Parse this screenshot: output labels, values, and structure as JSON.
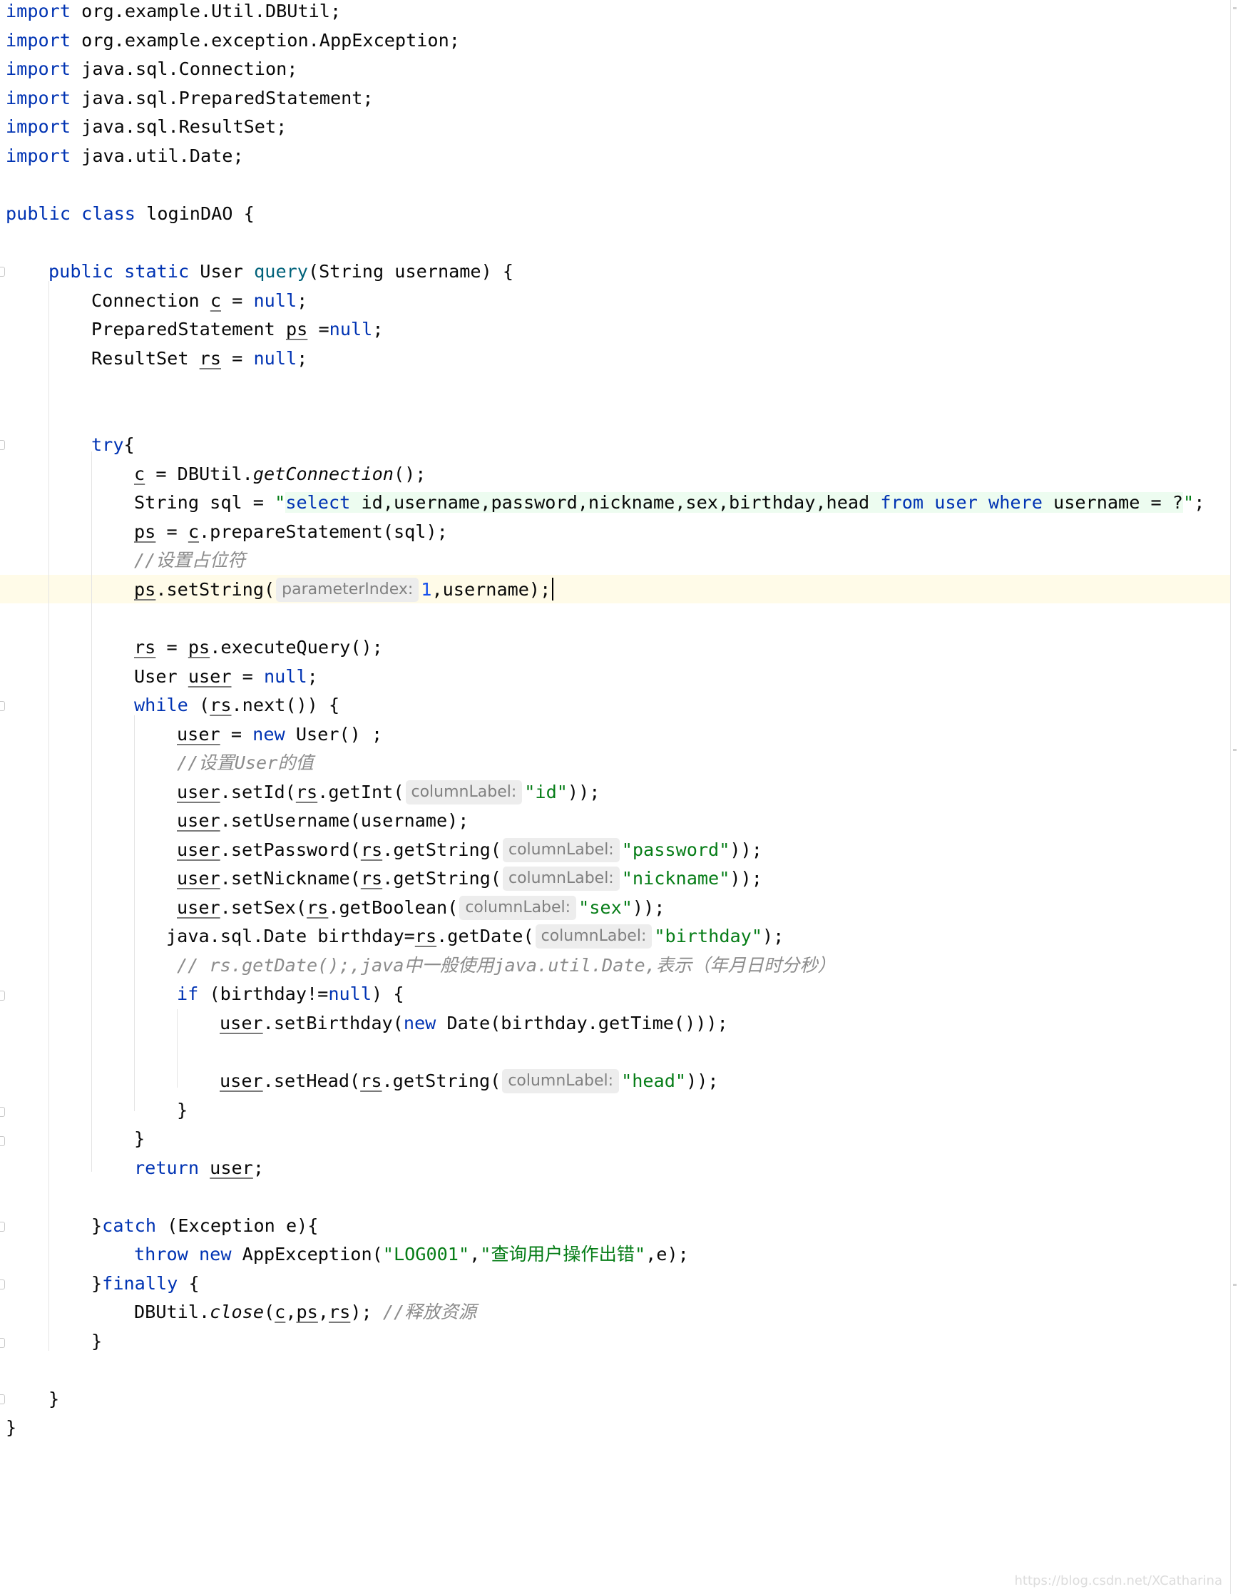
{
  "editor": {
    "caret_line": 21,
    "colors": {
      "keyword": "#0033b3",
      "string": "#067d17",
      "number": "#1750eb",
      "comment": "#8c8c8c",
      "method_decl": "#00627a",
      "hint_background": "#ededed",
      "caret_line_background": "#fffbe8",
      "injected_sql_background": "#edfcf0"
    },
    "lines": {
      "l1": {
        "kw": "import",
        "rest": " org.example.Util.DBUtil;"
      },
      "l2": {
        "kw": "import",
        "rest": " org.example.exception.AppException;"
      },
      "l3": {
        "kw": "import",
        "rest": " java.sql.Connection;"
      },
      "l4": {
        "kw": "import",
        "rest": " java.sql.PreparedStatement;"
      },
      "l5": {
        "kw": "import",
        "rest": " java.sql.ResultSet;"
      },
      "l6": {
        "kw": "import",
        "rest": " java.util.Date;"
      },
      "l8": {
        "kw": "public class",
        "rest": " loginDAO {"
      },
      "l10": {
        "kw": "public static",
        "t1": " User ",
        "method": "query",
        "t2": "(String username) {"
      },
      "l11": {
        "t1": "Connection ",
        "var": "c",
        "t2": " = ",
        "kw": "null",
        "t3": ";"
      },
      "l12": {
        "t1": "PreparedStatement ",
        "var": "ps",
        "t2": " =",
        "kw": "null",
        "t3": ";"
      },
      "l13": {
        "t1": "ResultSet ",
        "var": "rs",
        "t2": " = ",
        "kw": "null",
        "t3": ";"
      },
      "l16": {
        "kw": "try",
        "t1": "{"
      },
      "l17": {
        "var": "c",
        "t1": " = DBUtil.",
        "static": "getConnection",
        "t2": "();"
      },
      "l18": {
        "t1": "String sql = ",
        "q1": "\"",
        "sql_kw1": "select",
        "sql_cols": " id,username,password,nickname,sex,birthday,head ",
        "sql_kw2": "from",
        "sql_sp1": " ",
        "sql_kw3": "user",
        "sql_sp2": " ",
        "sql_kw4": "where",
        "sql_tail": " username = ?",
        "q2": "\"",
        "t2": ";"
      },
      "l19": {
        "var1": "ps",
        "t1": " = ",
        "var2": "c",
        "t2": ".prepareStatement(sql);"
      },
      "l20": {
        "comment": "//设置占位符"
      },
      "l21": {
        "var": "ps",
        "t1": ".setString(",
        "hint": "parameterIndex:",
        "num": "1",
        "t2": ",username);"
      },
      "l23": {
        "var1": "rs",
        "t1": " = ",
        "var2": "ps",
        "t2": ".executeQuery();"
      },
      "l24": {
        "t1": "User ",
        "var": "user",
        "t2": " = ",
        "kw": "null",
        "t3": ";"
      },
      "l25": {
        "kw": "while",
        "t1": " (",
        "var": "rs",
        "t2": ".next()) {"
      },
      "l26": {
        "var": "user",
        "t1": " = ",
        "kw": "new",
        "t2": " User() ;"
      },
      "l27": {
        "comment": "//设置User的值"
      },
      "l28": {
        "var1": "user",
        "t1": ".setId(",
        "var2": "rs",
        "t2": ".getInt(",
        "hint": "columnLabel:",
        "str": "\"id\"",
        "t3": "));"
      },
      "l29": {
        "var": "user",
        "t1": ".setUsername(username);"
      },
      "l30": {
        "var1": "user",
        "t1": ".setPassword(",
        "var2": "rs",
        "t2": ".getString(",
        "hint": "columnLabel:",
        "str": "\"password\"",
        "t3": "));"
      },
      "l31": {
        "var1": "user",
        "t1": ".setNickname(",
        "var2": "rs",
        "t2": ".getString(",
        "hint": "columnLabel:",
        "str": "\"nickname\"",
        "t3": "));"
      },
      "l32": {
        "var1": "user",
        "t1": ".setSex(",
        "var2": "rs",
        "t2": ".getBoolean(",
        "hint": "columnLabel:",
        "str": "\"sex\"",
        "t3": "));"
      },
      "l33": {
        "t1": "java.sql.Date birthday=",
        "var": "rs",
        "t2": ".getDate(",
        "hint": "columnLabel:",
        "str": "\"birthday\"",
        "t3": ");"
      },
      "l34": {
        "comment": "// rs.getDate();,java中一般使用java.util.Date,表示（年月日时分秒）"
      },
      "l35": {
        "kw": "if",
        "t1": " (birthday!=",
        "kw2": "null",
        "t2": ") {"
      },
      "l36": {
        "var": "user",
        "t1": ".setBirthday(",
        "kw": "new",
        "t2": " Date(birthday.getTime()));"
      },
      "l38": {
        "var1": "user",
        "t1": ".setHead(",
        "var2": "rs",
        "t2": ".getString(",
        "hint": "columnLabel:",
        "str": "\"head\"",
        "t3": "));"
      },
      "l39": {
        "t1": "}"
      },
      "l40": {
        "t1": "}"
      },
      "l41": {
        "kw": "return",
        "t1": " ",
        "var": "user",
        "t2": ";"
      },
      "l43": {
        "t1": "}",
        "kw": "catch",
        "t2": " (Exception e){"
      },
      "l44": {
        "kw": "throw new",
        "t1": " AppException(",
        "str1": "\"LOG001\"",
        "t2": ",",
        "str2": "\"查询用户操作出错\"",
        "t3": ",e);"
      },
      "l45": {
        "t1": "}",
        "kw": "finally",
        "t2": " {"
      },
      "l46": {
        "t1": "DBUtil.",
        "static": "close",
        "t2": "(",
        "var1": "c",
        "c1": ",",
        "var2": "ps",
        "c2": ",",
        "var3": "rs",
        "t3": "); ",
        "comment": "//释放资源"
      },
      "l47": {
        "t1": "}"
      },
      "l49": {
        "t1": "}"
      },
      "l50": {
        "t1": "}"
      }
    }
  },
  "watermark": "https://blog.csdn.net/XCatharina"
}
